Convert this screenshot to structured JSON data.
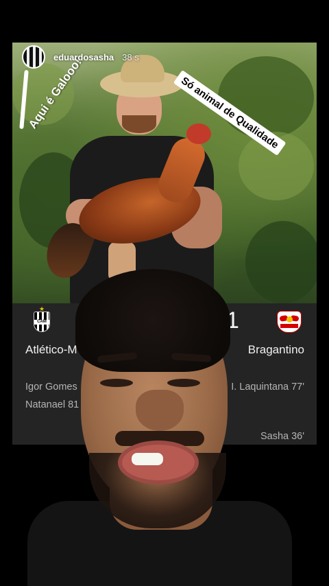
{
  "story": {
    "username": "eduardosasha",
    "time": "38 s",
    "caption_left": "Aqui é Galooo!",
    "caption_right": "Só animal de Qualidade"
  },
  "scorecard": {
    "home_team": "Atlético-M",
    "away_team": "Bragantino",
    "away_score": "1",
    "home_scorers": [
      "Igor Gomes",
      "Natanael 81"
    ],
    "away_scorers": [
      "I. Laquintana 77'",
      "Sasha 36'"
    ],
    "colors": {
      "card_bg": "#242424",
      "text": "#f0f0f0",
      "muted": "#b5b5b5"
    }
  },
  "icons": {
    "home_logo": "atletico-mineiro-crest-icon",
    "away_logo": "red-bull-bragantino-crest-icon"
  }
}
